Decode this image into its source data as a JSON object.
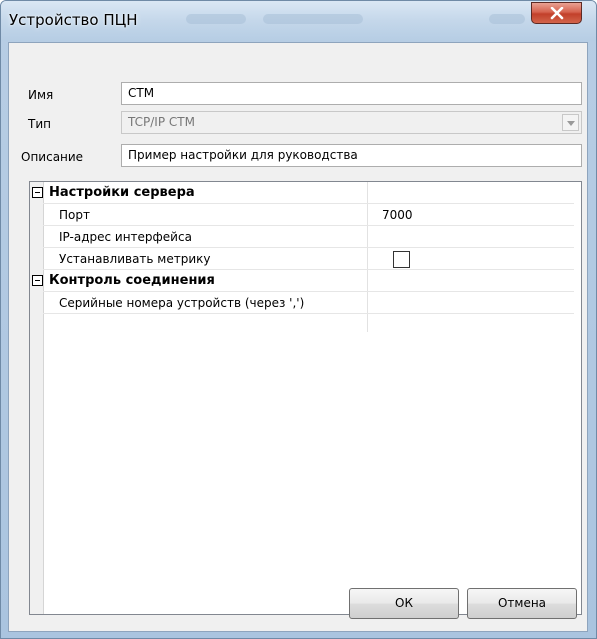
{
  "window": {
    "title": "Устройство ПЦН"
  },
  "form": {
    "name_label": "Имя",
    "name_value": "СТМ",
    "type_label": "Тип",
    "type_value": "TCP/IP СТМ",
    "description_label": "Описание",
    "description_value": "Пример настройки для руководства"
  },
  "properties": {
    "server_category": "Настройки сервера",
    "port_label": "Порт",
    "port_value": "7000",
    "ip_label": "IP-адрес интерфейса",
    "ip_value": "",
    "metric_label": "Устанавливать метрику",
    "metric_checked": false,
    "connection_category": "Контроль соединения",
    "serials_label": "Серийные номера устройств (через ',')",
    "serials_value": ""
  },
  "buttons": {
    "ok_label": "ОК",
    "cancel_label": "Отмена"
  }
}
